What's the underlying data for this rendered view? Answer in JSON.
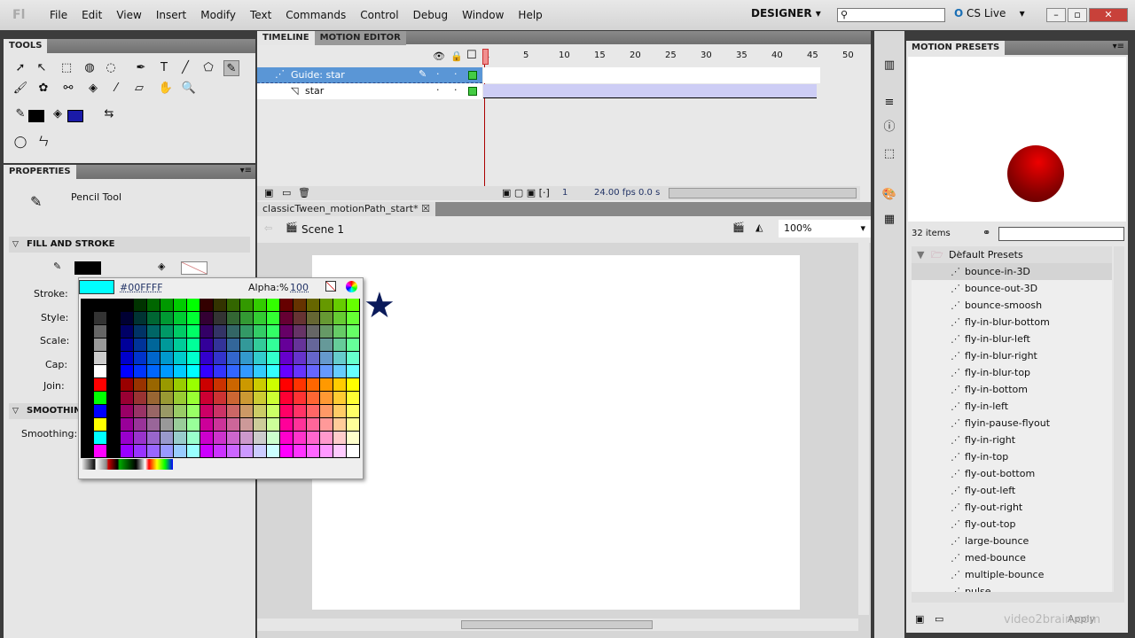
{
  "menu": {
    "logo": "Fl",
    "items": [
      "File",
      "Edit",
      "View",
      "Insert",
      "Modify",
      "Text",
      "Commands",
      "Control",
      "Debug",
      "Window",
      "Help"
    ],
    "workspace": "DESIGNER",
    "cs_live": "CS Live"
  },
  "tools_panel": {
    "title": "TOOLS"
  },
  "properties": {
    "title": "PROPERTIES",
    "tool_name": "Pencil Tool",
    "fill_stroke": "FILL AND STROKE",
    "stroke_label": "Stroke:",
    "style_label": "Style:",
    "scale_label": "Scale:",
    "cap_label": "Cap:",
    "join_label": "Join:",
    "smoothing_section": "SMOOTHIN",
    "smoothing_label": "Smoothing:"
  },
  "picker": {
    "hex": "#00FFFF",
    "alpha_label": "Alpha:%",
    "alpha": "100",
    "preview_color": "#00FFFF"
  },
  "timeline": {
    "tabs": [
      "TIMELINE",
      "MOTION EDITOR"
    ],
    "frame_numbers": [
      "1",
      "5",
      "10",
      "15",
      "20",
      "25",
      "30",
      "35",
      "40",
      "45",
      "50"
    ],
    "layers": [
      {
        "name": "Guide: star",
        "selected": true
      },
      {
        "name": "star",
        "selected": false
      }
    ],
    "current_frame": "1",
    "fps": "24.00 fps",
    "time": "0.0 s"
  },
  "document": {
    "tab": "classicTween_motionPath_start*",
    "scene": "Scene 1",
    "zoom": "100%"
  },
  "motion_presets": {
    "title": "MOTION PRESETS",
    "count": "32 items",
    "folder": "Default Presets",
    "items": [
      "bounce-in-3D",
      "bounce-out-3D",
      "bounce-smoosh",
      "fly-in-blur-bottom",
      "fly-in-blur-left",
      "fly-in-blur-right",
      "fly-in-blur-top",
      "fly-in-bottom",
      "fly-in-left",
      "flyin-pause-flyout",
      "fly-in-right",
      "fly-in-top",
      "fly-out-bottom",
      "fly-out-left",
      "fly-out-right",
      "fly-out-top",
      "large-bounce",
      "med-bounce",
      "multiple-bounce",
      "pulse"
    ],
    "apply": "Apply"
  },
  "watermark": "video2brain.com"
}
